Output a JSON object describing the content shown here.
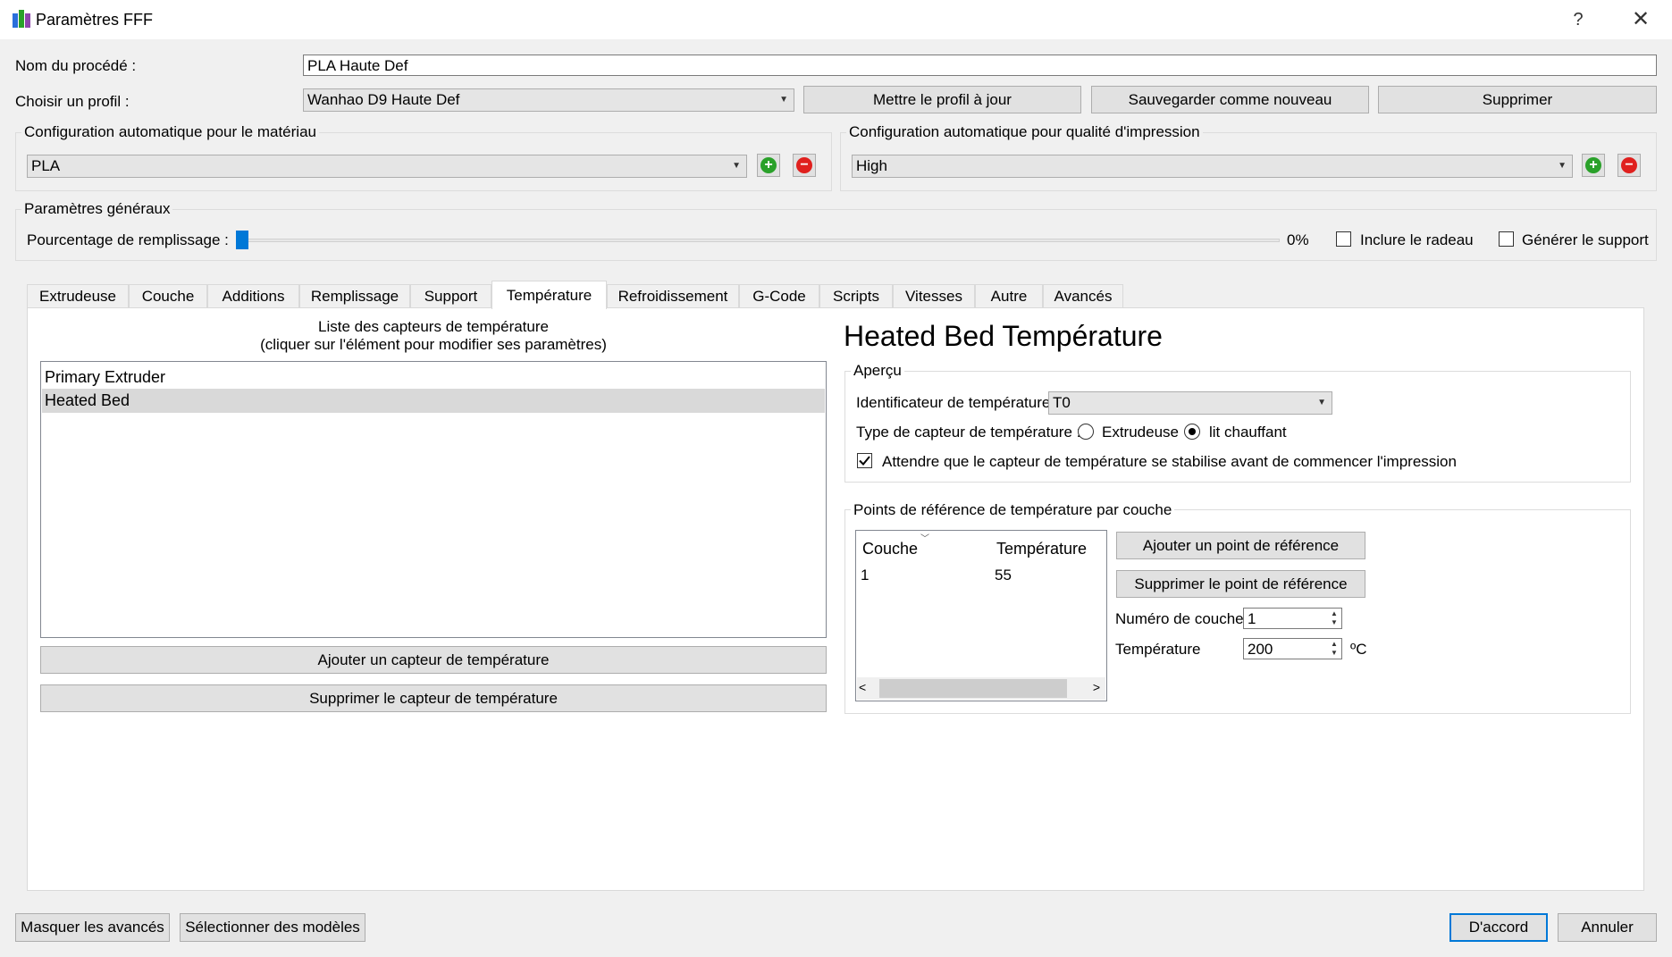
{
  "window": {
    "title": "Paramètres FFF",
    "help": "?",
    "close": "✕"
  },
  "process": {
    "label": "Nom du procédé :",
    "value": "PLA Haute Def"
  },
  "profile": {
    "label": "Choisir un profil :",
    "selected": "Wanhao D9 Haute Def",
    "update_button": "Mettre le profil à jour",
    "save_new_button": "Sauvegarder comme nouveau",
    "delete_button": "Supprimer"
  },
  "material_config": {
    "title": "Configuration automatique pour le matériau",
    "selected": "PLA"
  },
  "quality_config": {
    "title": "Configuration automatique pour qualité d'impression",
    "selected": "High"
  },
  "general": {
    "title": "Paramètres généraux",
    "infill_label": "Pourcentage de remplissage :",
    "infill_value": "0%",
    "infill_fraction": 0,
    "raft_label": "Inclure le radeau",
    "raft_checked": false,
    "support_label": "Générer le support",
    "support_checked": false
  },
  "tabs": [
    "Extrudeuse",
    "Couche",
    "Additions",
    "Remplissage",
    "Support",
    "Température",
    "Refroidissement",
    "G-Code",
    "Scripts",
    "Vitesses",
    "Autre",
    "Avancés"
  ],
  "active_tab": "Température",
  "sensors": {
    "header_line1": "Liste des capteurs de température",
    "header_line2": "(cliquer sur l'élément pour modifier ses paramètres)",
    "items": [
      "Primary Extruder",
      "Heated Bed"
    ],
    "selected": "Heated Bed",
    "add_button": "Ajouter un capteur de température",
    "remove_button": "Supprimer le capteur de température"
  },
  "detail": {
    "heading": "Heated Bed Température",
    "overview_title": "Aperçu",
    "identifier_label": "Identificateur de température",
    "identifier_value": "T0",
    "type_label": "Type de capteur de température :",
    "type_option_extruder": "Extrudeuse",
    "type_option_bed": "lit chauffant",
    "type_selected": "lit chauffant",
    "wait_label": "Attendre que le capteur de température se stabilise avant de commencer l'impression",
    "wait_checked": true
  },
  "setpoints": {
    "title": "Points de référence de température par couche",
    "columns": [
      "Couche",
      "Température"
    ],
    "rows": [
      [
        "1",
        "55"
      ]
    ],
    "add_button": "Ajouter un point de référence",
    "remove_button": "Supprimer le point de référence",
    "layer_label": "Numéro de couche",
    "layer_value": "1",
    "temp_label": "Température",
    "temp_value": "200",
    "temp_unit": "ºC"
  },
  "footer": {
    "hide_advanced": "Masquer les avancés",
    "select_models": "Sélectionner des modèles",
    "ok": "D'accord",
    "cancel": "Annuler"
  },
  "colors": {
    "accent": "#0078d7",
    "add": "#2aa12a",
    "remove": "#e0201e"
  }
}
